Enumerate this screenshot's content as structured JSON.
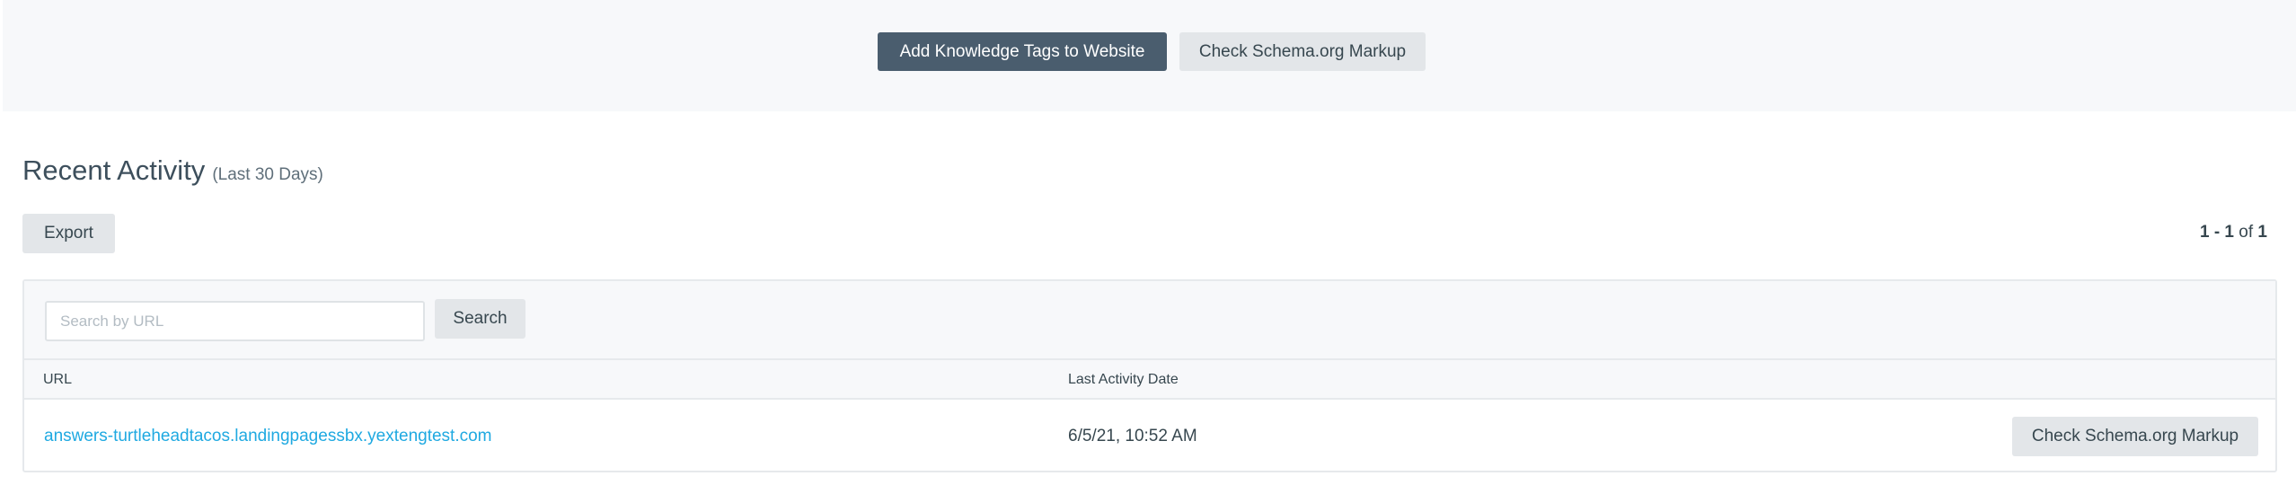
{
  "header": {
    "add_tags_label": "Add Knowledge Tags to Website",
    "check_schema_label": "Check Schema.org Markup"
  },
  "activity": {
    "title": "Recent Activity",
    "subtitle": "(Last 30 Days)",
    "export_label": "Export",
    "pagination": {
      "range": "1 - 1",
      "of_label": "of",
      "total": "1"
    }
  },
  "search": {
    "placeholder": "Search by URL",
    "value": "",
    "button_label": "Search"
  },
  "table": {
    "columns": [
      "URL",
      "Last Activity Date"
    ],
    "rows": [
      {
        "url": "answers-turtleheadtacos.landingpagessbx.yextengtest.com",
        "last_activity": "6/5/21, 10:52 AM",
        "action_label": "Check Schema.org Markup"
      }
    ]
  },
  "colors": {
    "primary_button": "#4a5d6e",
    "secondary_button": "#e3e6e9",
    "link": "#1fa9e1",
    "band_background": "#f7f8fa"
  }
}
